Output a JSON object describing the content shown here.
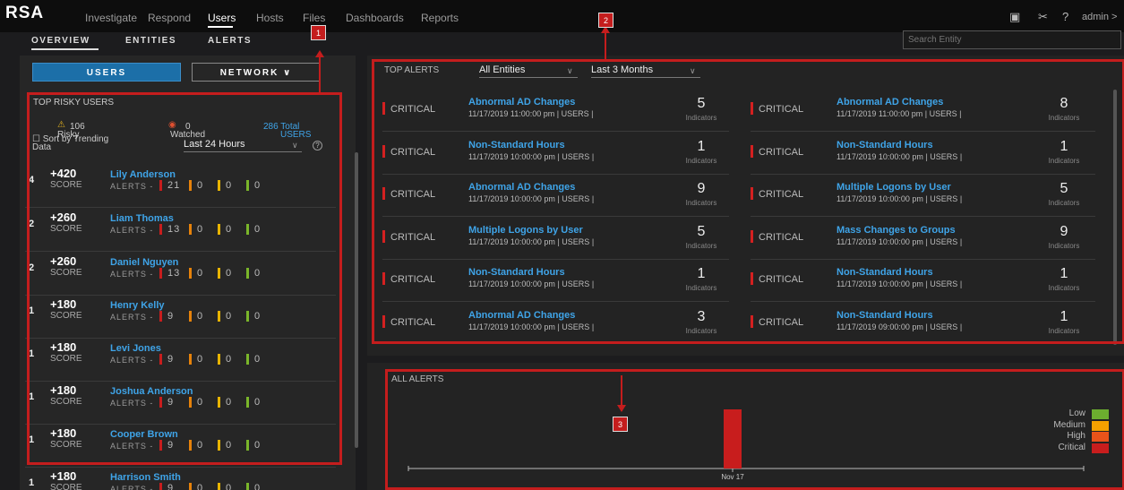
{
  "nav": {
    "logo": "RSA",
    "items": [
      "Investigate",
      "Respond",
      "Users",
      "Hosts",
      "Files",
      "Dashboards",
      "Reports"
    ],
    "user": "admin >"
  },
  "subnav": [
    "OVERVIEW",
    "ENTITIES",
    "ALERTS"
  ],
  "search": {
    "placeholder": "Search Entity"
  },
  "left": {
    "users_btn": "USERS",
    "network_btn": "NETWORK",
    "title": "TOP RISKY USERS",
    "risky_count": "106",
    "risky_label": "Risky",
    "watched_count": "0",
    "watched_label": "Watched",
    "total_count": "286 Total",
    "total_label": "USERS",
    "sort_label": "Sort by Trending",
    "sort_label2": "Data",
    "period": "Last 24 Hours",
    "score_label": "SCORE",
    "alerts_label": "ALERTS -",
    "users": [
      {
        "rank": "4",
        "score": "+420",
        "name": "Lily Anderson",
        "c1": "21",
        "c2": "0",
        "c3": "0",
        "c4": "0"
      },
      {
        "rank": "2",
        "score": "+260",
        "name": "Liam Thomas",
        "c1": "13",
        "c2": "0",
        "c3": "0",
        "c4": "0"
      },
      {
        "rank": "2",
        "score": "+260",
        "name": "Daniel Nguyen",
        "c1": "13",
        "c2": "0",
        "c3": "0",
        "c4": "0"
      },
      {
        "rank": "1",
        "score": "+180",
        "name": "Henry Kelly",
        "c1": "9",
        "c2": "0",
        "c3": "0",
        "c4": "0"
      },
      {
        "rank": "1",
        "score": "+180",
        "name": "Levi Jones",
        "c1": "9",
        "c2": "0",
        "c3": "0",
        "c4": "0"
      },
      {
        "rank": "1",
        "score": "+180",
        "name": "Joshua Anderson",
        "c1": "9",
        "c2": "0",
        "c3": "0",
        "c4": "0"
      },
      {
        "rank": "1",
        "score": "+180",
        "name": "Cooper Brown",
        "c1": "9",
        "c2": "0",
        "c3": "0",
        "c4": "0"
      },
      {
        "rank": "1",
        "score": "+180",
        "name": "Harrison Smith",
        "c1": "9",
        "c2": "0",
        "c3": "0",
        "c4": "0"
      }
    ]
  },
  "top_alerts": {
    "title": "TOP ALERTS",
    "entity_filter": "All Entities",
    "period_filter": "Last 3 Months",
    "severity": "CRITICAL",
    "indicators_label": "Indicators",
    "sep": "|",
    "rows": [
      {
        "a": {
          "title": "Abnormal AD Changes",
          "time": "11/17/2019 11:00:00 pm",
          "type": "USERS",
          "count": "5"
        },
        "b": {
          "title": "Abnormal AD Changes",
          "time": "11/17/2019 11:00:00 pm",
          "type": "USERS",
          "count": "8"
        }
      },
      {
        "a": {
          "title": "Non-Standard Hours",
          "time": "11/17/2019 10:00:00 pm",
          "type": "USERS",
          "count": "1"
        },
        "b": {
          "title": "Non-Standard Hours",
          "time": "11/17/2019 10:00:00 pm",
          "type": "USERS",
          "count": "1"
        }
      },
      {
        "a": {
          "title": "Abnormal AD Changes",
          "time": "11/17/2019 10:00:00 pm",
          "type": "USERS",
          "count": "9"
        },
        "b": {
          "title": "Multiple Logons by User",
          "time": "11/17/2019 10:00:00 pm",
          "type": "USERS",
          "count": "5"
        }
      },
      {
        "a": {
          "title": "Multiple Logons by User",
          "time": "11/17/2019 10:00:00 pm",
          "type": "USERS",
          "count": "5"
        },
        "b": {
          "title": "Mass Changes to Groups",
          "time": "11/17/2019 10:00:00 pm",
          "type": "USERS",
          "count": "9"
        }
      },
      {
        "a": {
          "title": "Non-Standard Hours",
          "time": "11/17/2019 10:00:00 pm",
          "type": "USERS",
          "count": "1"
        },
        "b": {
          "title": "Non-Standard Hours",
          "time": "11/17/2019 10:00:00 pm",
          "type": "USERS",
          "count": "1"
        }
      },
      {
        "a": {
          "title": "Abnormal AD Changes",
          "time": "11/17/2019 10:00:00 pm",
          "type": "USERS",
          "count": "3"
        },
        "b": {
          "title": "Non-Standard Hours",
          "time": "11/17/2019 09:00:00 pm",
          "type": "USERS",
          "count": "1"
        }
      }
    ]
  },
  "all_alerts": {
    "title": "ALL ALERTS",
    "legend": [
      {
        "label": "Low",
        "color": "#6cae2f"
      },
      {
        "label": "Medium",
        "color": "#f5a000"
      },
      {
        "label": "High",
        "color": "#e8531a"
      },
      {
        "label": "Critical",
        "color": "#c81d1d"
      }
    ]
  },
  "chart_data": {
    "type": "bar",
    "categories": [
      "Nov 17"
    ],
    "series": [
      {
        "name": "Critical",
        "values": [
          1
        ]
      }
    ],
    "xlabel": "",
    "ylabel": ""
  },
  "annotations": [
    "1",
    "2",
    "3"
  ],
  "colors": {
    "accent": "#3fa4e8",
    "annotation": "#c41d1d",
    "critical": "#d42020"
  },
  "icons": [
    "report-icon",
    "tools-icon",
    "help-icon",
    "chevron-down-icon",
    "eye-icon",
    "risk-icon"
  ]
}
